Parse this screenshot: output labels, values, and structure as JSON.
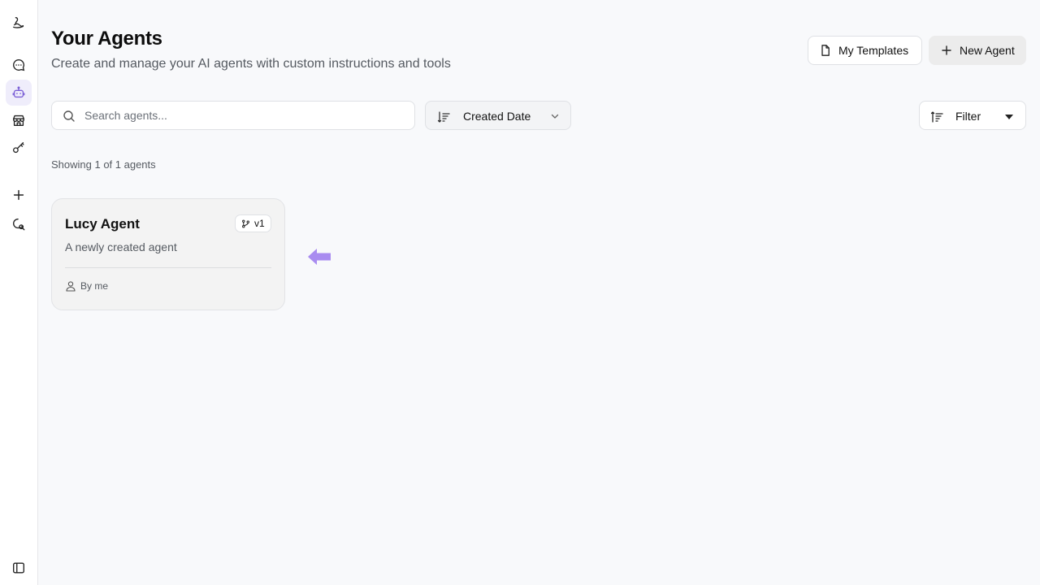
{
  "sidebar": {
    "items": [
      {
        "icon": "logo-icon"
      },
      {
        "icon": "chat-icon"
      },
      {
        "icon": "agent-bot-icon",
        "active": true
      },
      {
        "icon": "marketplace-store-icon"
      },
      {
        "icon": "key-icon"
      },
      {
        "icon": "plus-icon"
      },
      {
        "icon": "search-chat-icon"
      },
      {
        "icon": "sidebar-toggle-icon"
      }
    ]
  },
  "header": {
    "title": "Your Agents",
    "subtitle": "Create and manage your AI agents with custom instructions and tools",
    "templates_label": "My Templates",
    "new_agent_label": "New Agent"
  },
  "toolbar": {
    "search_placeholder": "Search agents...",
    "sort_label": "Created Date",
    "filter_label": "Filter"
  },
  "results": {
    "count_text": "Showing 1 of 1 agents"
  },
  "agents": [
    {
      "name": "Lucy Agent",
      "version": "v1",
      "description": "A newly created agent",
      "author": "By me"
    }
  ],
  "colors": {
    "accent": "#a98cf0",
    "active_bg": "#efedfb",
    "page_bg": "#f8f9fb"
  }
}
